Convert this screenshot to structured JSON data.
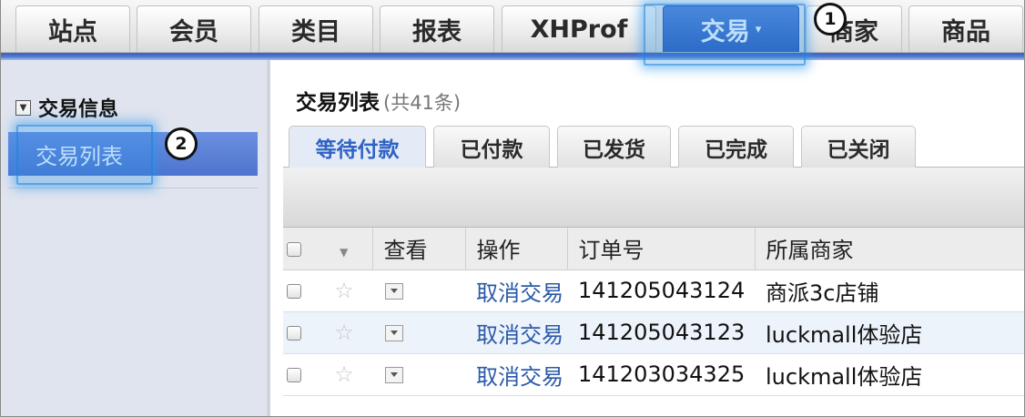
{
  "topnav": {
    "tabs": [
      {
        "label": "站点"
      },
      {
        "label": "会员"
      },
      {
        "label": "类目"
      },
      {
        "label": "报表"
      },
      {
        "label": "XHProf"
      },
      {
        "label": "交易",
        "caret": "▾",
        "active": true
      },
      {
        "label": "商家"
      },
      {
        "label": "商品"
      }
    ]
  },
  "callouts": {
    "first": "1",
    "second": "2"
  },
  "sidebar": {
    "section_title": "交易信息",
    "items": [
      {
        "label": "交易列表",
        "selected": true
      }
    ]
  },
  "main": {
    "title": "交易列表",
    "count": "(共41条)",
    "subtabs": [
      {
        "label": "等待付款",
        "active": true
      },
      {
        "label": "已付款"
      },
      {
        "label": "已发货"
      },
      {
        "label": "已完成"
      },
      {
        "label": "已关闭"
      }
    ]
  },
  "table": {
    "columns": [
      "查看",
      "操作",
      "订单号",
      "所属商家"
    ],
    "rows": [
      {
        "action": "取消交易",
        "order_no": "141205043124",
        "merchant": "商派3c店铺"
      },
      {
        "action": "取消交易",
        "order_no": "141205043123",
        "merchant": "luckmall体验店"
      },
      {
        "action": "取消交易",
        "order_no": "141203034325",
        "merchant": "luckmall体验店"
      }
    ]
  },
  "colors": {
    "accent": "#2f5cb8",
    "highlight": "#2492ec",
    "link": "#2b5aa8"
  }
}
